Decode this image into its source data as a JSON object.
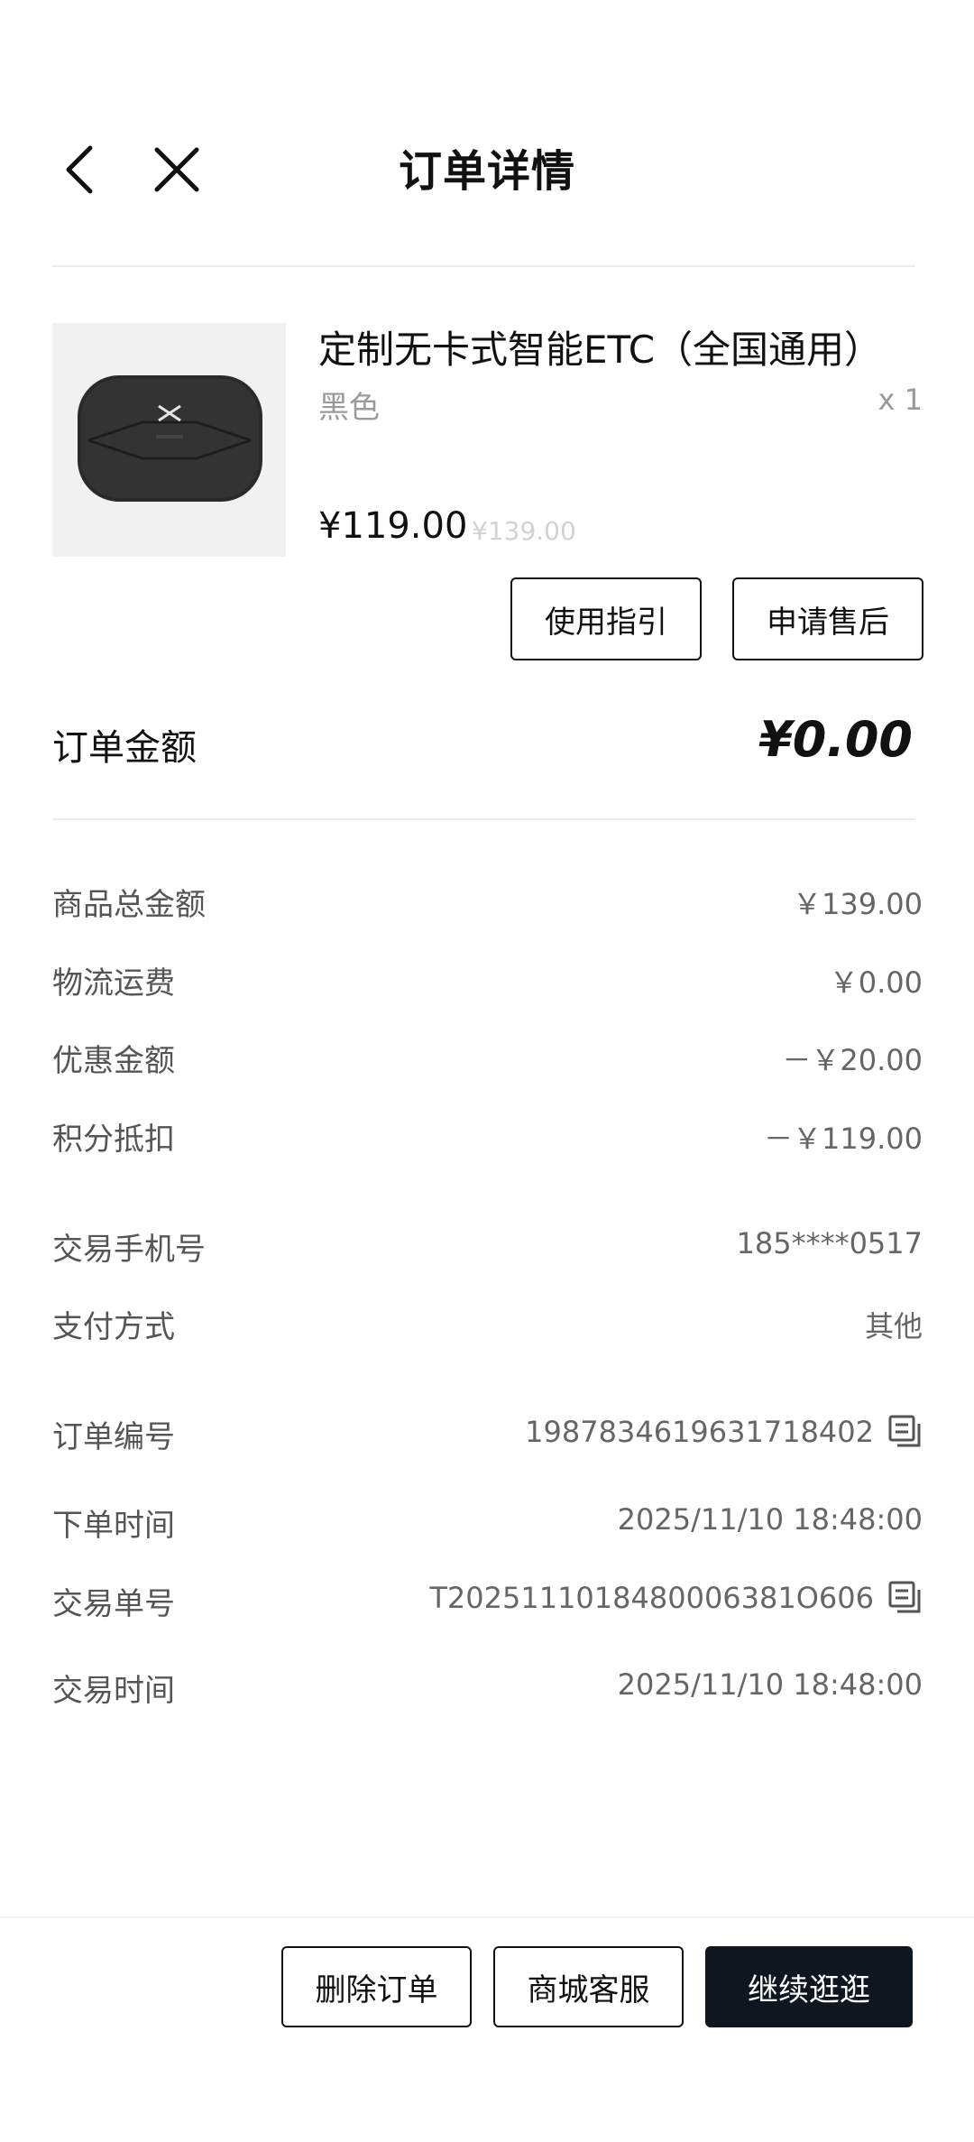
{
  "header": {
    "title": "订单详情",
    "back_icon": "chevron-left-icon",
    "close_icon": "close-icon"
  },
  "product": {
    "name": "定制无卡式智能ETC（全国通用）",
    "variant": "黑色",
    "quantity": "x 1",
    "price": "¥119.00",
    "original_price": "¥139.00",
    "image_icon": "etc-device-image"
  },
  "actions": {
    "guide": "使用指引",
    "after_sale": "申请售后"
  },
  "order_amount": {
    "label": "订单金额",
    "value": "¥0.00"
  },
  "details": [
    {
      "label": "商品总金额",
      "value": "￥139.00"
    },
    {
      "label": "物流运费",
      "value": "￥0.00"
    },
    {
      "label": "优惠金额",
      "value": "－￥20.00"
    },
    {
      "label": "积分抵扣",
      "value": "－￥119.00"
    },
    {
      "label": "交易手机号",
      "value": "185****0517"
    },
    {
      "label": "支付方式",
      "value": "其他"
    },
    {
      "label": "订单编号",
      "value": "1987834619631718402"
    },
    {
      "label": "下单时间",
      "value": "2025/11/10 18:48:00"
    },
    {
      "label": "交易单号",
      "value": "T2025111018480006381O606"
    },
    {
      "label": "交易时间",
      "value": "2025/11/10 18:48:00"
    }
  ],
  "bottom": {
    "delete": "删除订单",
    "service": "商城客服",
    "continue": "继续逛逛"
  },
  "colors": {
    "primary_dark": "#0e1620",
    "text": "#111111",
    "muted": "#9a9a9a"
  }
}
